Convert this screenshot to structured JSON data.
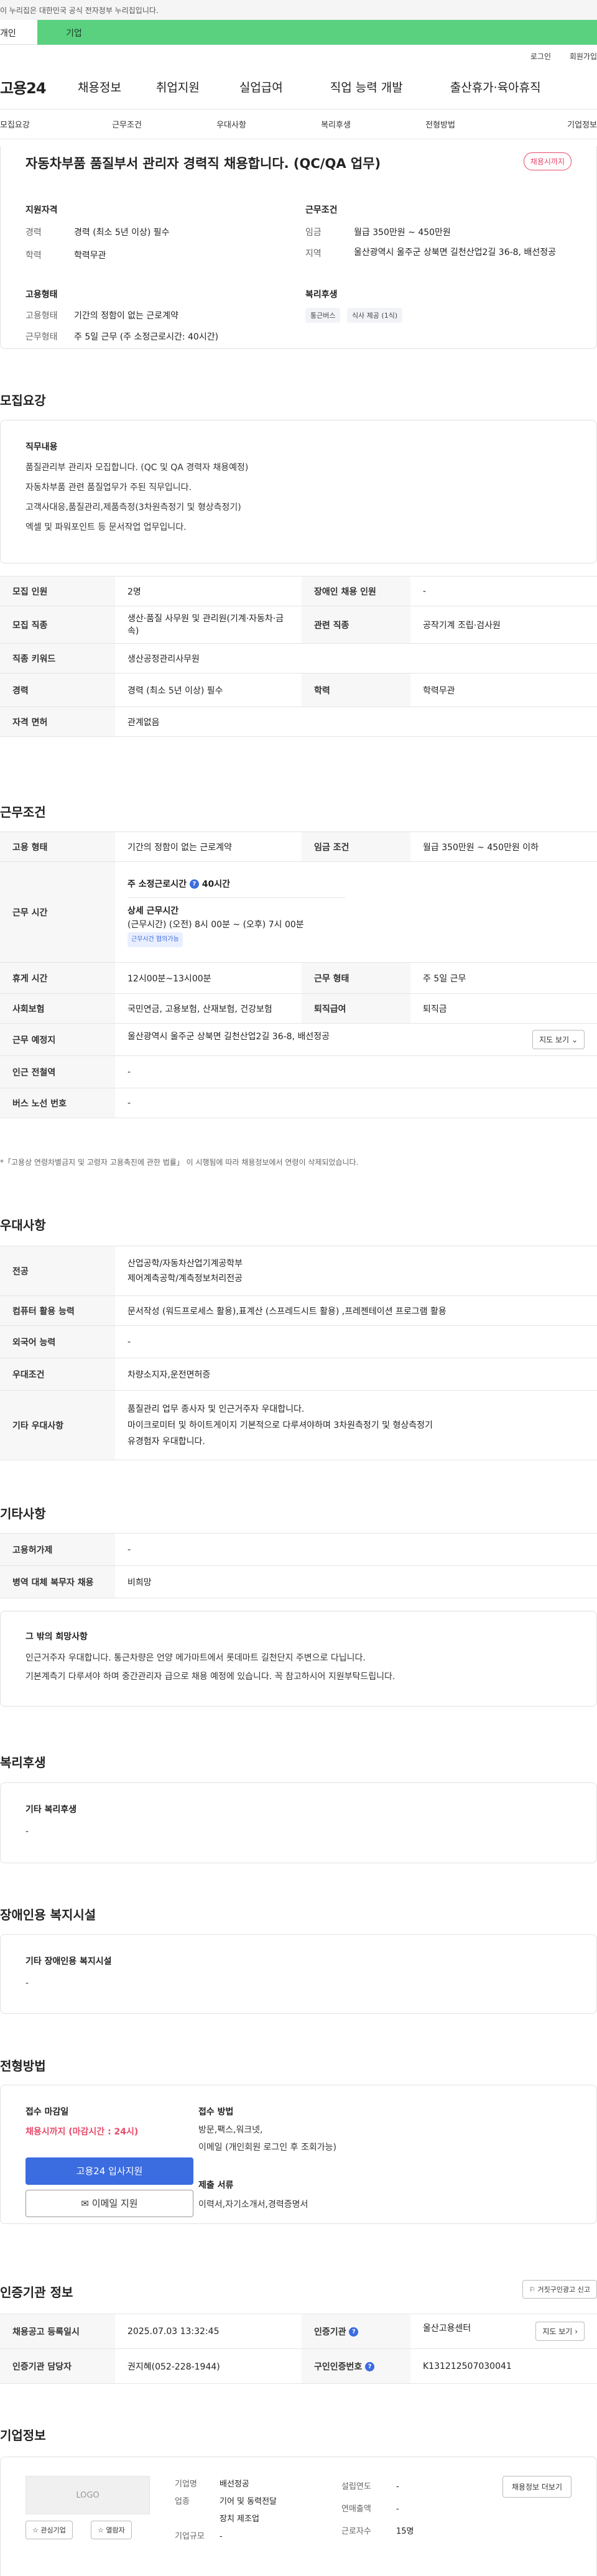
{
  "gov_banner": "이 누리집은 대한민국 공식 전자정부 누리집입니다.",
  "tabs": {
    "personal": "개인",
    "company": "기업"
  },
  "util": {
    "login": "로그인",
    "signup": "회원가입"
  },
  "gnb": {
    "logo": "고용24",
    "menu": [
      "채용정보",
      "취업지원",
      "실업급여",
      "직업 능력 개발",
      "출산휴가·육아휴직"
    ]
  },
  "subnav": [
    "모집요강",
    "근무조건",
    "우대사항",
    "복리후생",
    "전형방법",
    "기업정보"
  ],
  "title_card": {
    "title": "자동차부품 품질부서 관리자 경력직 채용합니다. (QC/QA 업무)",
    "badge": "채용시까지",
    "qual_h": "지원자격",
    "career_k": "경력",
    "career_v": "경력 (최소 5년 이상) 필수",
    "edu_k": "학력",
    "edu_v": "학력무관",
    "cond_h": "근무조건",
    "wage_k": "임금",
    "wage_v": "월급 350만원 ~ 450만원",
    "region_k": "지역",
    "region_v": "울산광역시 울주군 상북면 길천산업2길 36-8, 배선정공",
    "emp_h": "고용형태",
    "emptype_k": "고용형태",
    "emptype_v": "기간의 정함이 없는 근로계약",
    "worktype_k": "근무형태",
    "worktype_v": "주 5일 근무 (주 소정근로시간: 40시간)",
    "welfare_h": "복리후생",
    "welfare_chips": [
      "통근버스",
      "식사 제공 (1식)"
    ]
  },
  "recruit": {
    "heading": "모집요강",
    "duty_h": "직무내용",
    "duty_lines": [
      "품질관리부 관리자 모집합니다. (QC 및 QA 경력자 채용예정)",
      "자동차부품 관련 품질업무가 주된 직무입니다.",
      "고객사대응,품질관리,제품측정(3차원측정기 및 형상측정기)",
      "엑셀 및 파워포인트 등 문서작업 업무입니다."
    ],
    "rows": [
      [
        "모집 인원",
        "2명",
        "장애인 채용 인원",
        "-"
      ],
      [
        "모집 직종",
        "생산·품질 사무원 및 관리원(기계·자동차·금속)",
        "관련 직종",
        "공작기계 조립·검사원"
      ],
      [
        "직종 키워드",
        "생산공정관리사무원"
      ],
      [
        "경력",
        "경력 (최소 5년 이상) 필수",
        "학력",
        "학력무관"
      ],
      [
        "자격 면허",
        "관계없음"
      ]
    ]
  },
  "conditions": {
    "heading": "근무조건",
    "emp_type_k": "고용 형태",
    "emp_type_v": "기간의 정함이 없는 근로계약",
    "wage_k": "임금 조건",
    "wage_v": "월급 350만원 ~ 450만원 이하",
    "hours_k": "근무 시간",
    "weekly_label": "주 소정근로시간",
    "weekly_v": "40시간",
    "detail_label": "상세 근무시간",
    "detail_v": "(근무시간) (오전) 8시 00분 ~ (오후) 7시 00분",
    "flex_chip": "근무시간 협의가능",
    "break_k": "휴게 시간",
    "break_v": "12시00분~13시00분",
    "shift_k": "근무 형태",
    "shift_v": "주 5일 근무",
    "insurance_k": "사회보험",
    "insurance_v": "국민연금, 고용보험, 산재보험, 건강보험",
    "severance_k": "퇴직급여",
    "severance_v": "퇴직금",
    "location_k": "근무 예정지",
    "location_v": "울산광역시 울주군 상북면 길천산업2길 36-8, 배선정공",
    "map_btn": "지도 보기",
    "subway_k": "인근 전철역",
    "subway_v": "-",
    "bus_k": "버스 노선 번호",
    "bus_v": "-",
    "note": "*「고용상 연령차별금지 및 고령자 고용촉진에 관한 법률」 이 시행됨에 따라 채용정보에서 연령이 삭제되었습니다."
  },
  "preferences": {
    "heading": "우대사항",
    "major_k": "전공",
    "major_v1": "산업공학/자동차산업기계공학부",
    "major_v2": "제어계측공학/계측정보처리전공",
    "computer_k": "컴퓨터 활용 능력",
    "computer_v": "문서작성 (워드프로세스 활용),표계산 (스프레드시트 활용) ,프레젠테이션 프로그램 활용",
    "lang_k": "외국어 능력",
    "lang_v": "-",
    "cond_k": "우대조건",
    "cond_v": "차량소지자,운전면허증",
    "etc_k": "기타 우대사항",
    "etc_v1": "품질관리 업무 종사자 및 인근거주자 우대합니다.",
    "etc_v2": "마이크로미터 및 하이트게이지 기본적으로 다루셔야하며 3차원측정기 및 형상측정기",
    "etc_v3": "유경험자 우대합니다."
  },
  "others": {
    "heading": "기타사항",
    "insurance_k": "고용허가제",
    "insurance_v": "-",
    "military_k": "병역 대체 복무자 채용",
    "military_v": "비희망",
    "hope_h": "그 밖의 희망사항",
    "hope_v1": "인근거주자 우대합니다. 통근차량은 언양 메가마트에서 롯데마트 길천단지 주변으로 다닙니다.",
    "hope_v2": "기본계측기 다루셔야 하며 중간관리자 급으로 채용 예정에 있습니다. 꼭 참고하시어 지원부탁드립니다."
  },
  "welfare": {
    "heading": "복리후생",
    "box_h": "기타 복리후생",
    "box_v": "-"
  },
  "disability": {
    "heading": "장애인용 복지시설",
    "box_h": "기타 장애인용 복지시설",
    "box_v": "-"
  },
  "selection": {
    "heading": "전형방법",
    "deadline_h": "접수 마감일",
    "deadline_v": "채용시까지 (마감시간 : 24시)",
    "apply_btn": "고용24 입사지원",
    "email_btn": "이메일 지원",
    "method_h": "접수 방법",
    "method_v1": "방문,팩스,워크넷,",
    "method_v2": "이메일 (개인회원 로그인 후 조회가능)",
    "docs_h": "제출 서류",
    "docs_v": "이력서,자기소개서,경력증명서"
  },
  "cert": {
    "heading": "인증기관 정보",
    "report_btn": "거짓구인광고 신고",
    "reg_k": "채용공고 등록일시",
    "reg_v": "2025.07.03 13:32:45",
    "org_k": "인증기관",
    "org_v": "울산고용센터",
    "map_btn": "지도 보기",
    "manager_k": "인증기관 담당자",
    "manager_v": "권지혜(052-228-1944)",
    "num_k": "구인인증번호",
    "num_v": "K131212507030041"
  },
  "company": {
    "heading": "기업정보",
    "logo": "LOGO",
    "fav_btn": "관심기업",
    "share_btn": "열람자",
    "name_k": "기업명",
    "name_v": "배선정공",
    "ind_k": "업종",
    "ind_v1": "기어 및 동력전달",
    "ind_v2": "장치 제조업",
    "size_k": "기업규모",
    "size_v": "-",
    "founded_k": "설립연도",
    "founded_v": "-",
    "sales_k": "연매출액",
    "sales_v": "-",
    "staff_k": "근로자수",
    "staff_v": "15명",
    "more_btn": "채용정보 더보기"
  }
}
